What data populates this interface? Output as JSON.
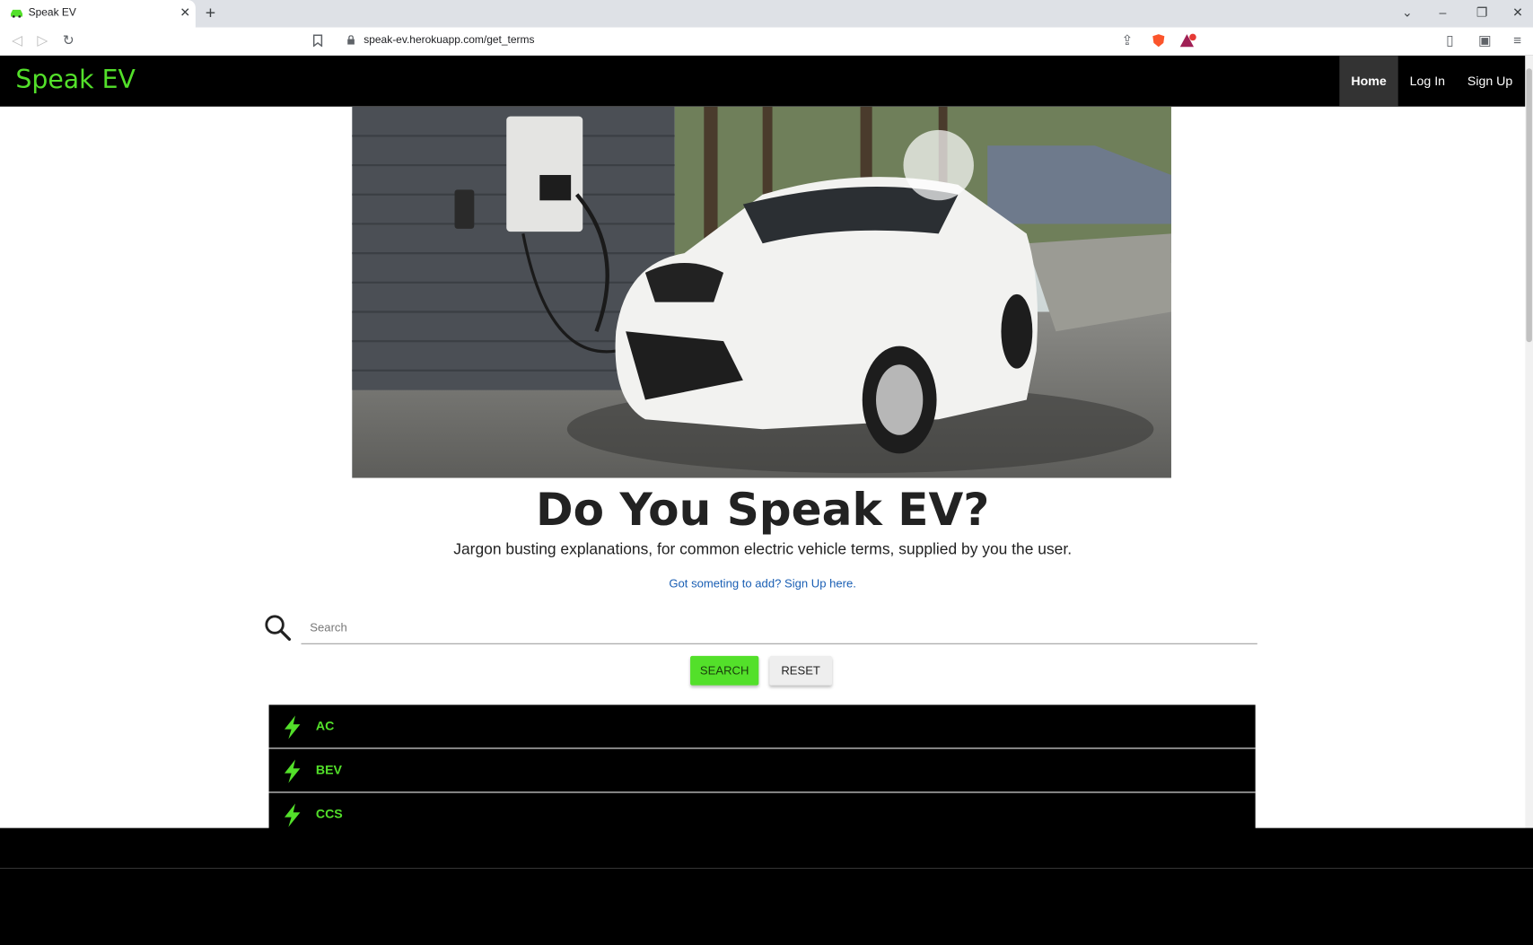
{
  "browser": {
    "tab_title": "Speak EV",
    "url": "speak-ev.herokuapp.com/get_terms"
  },
  "navbar": {
    "brand": "Speak EV",
    "links": [
      {
        "label": "Home",
        "active": true
      },
      {
        "label": "Log In",
        "active": false
      },
      {
        "label": "Sign Up",
        "active": false
      }
    ]
  },
  "hero": {
    "heading": "Do You Speak EV?",
    "lead": "Jargon busting explanations, for common electric vehicle terms, supplied by you the user.",
    "cta_link": "Got someting to add? Sign Up here."
  },
  "search": {
    "placeholder": "Search",
    "search_button": "SEARCH",
    "reset_button": "RESET"
  },
  "terms": [
    {
      "label": "AC"
    },
    {
      "label": "BEV"
    },
    {
      "label": "CCS"
    }
  ],
  "colors": {
    "accent_green": "#53e02a",
    "navbar_bg": "#000000",
    "link_blue": "#1a5fb4"
  }
}
